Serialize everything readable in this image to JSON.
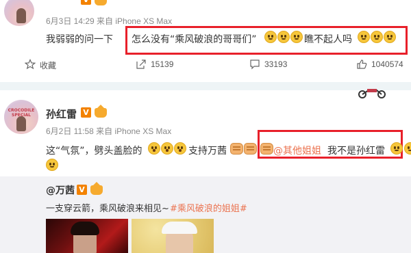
{
  "post1": {
    "date_source": "6月3日 14:29 来自 iPhone XS Max",
    "text_a": "我弱弱的问一下",
    "text_b": "怎么没有“乘风破浪的哥哥们”",
    "text_c": "瞧不起人吗",
    "actions": {
      "favorite": "收藏",
      "share": "15139",
      "comment": "33193",
      "like": "1040574"
    }
  },
  "post2": {
    "author": "孙红雷",
    "verified_badge": "V",
    "date_source": "6月2日 11:58 来自 iPhone XS Max",
    "text_a": "这“气氛”，劈头盖脸的",
    "text_b": "支持万茜",
    "mention": "@其他姐姐",
    "text_c": "我不是孙红雷",
    "avatar_text": [
      "CROCODILE",
      "SPECIAL"
    ]
  },
  "repost": {
    "author": "@万茜",
    "verified_badge": "V",
    "text_a": "一支穿云箭，乘风破浪来相见~",
    "hashtag": "#乘风破浪的姐姐#"
  },
  "colors": {
    "highlight_box": "#e8202a",
    "link": "#eb7350",
    "verified": "#f38200",
    "action_text": "#555555",
    "divider": "#eef4f6",
    "repost_bg": "#f2f2f5"
  }
}
